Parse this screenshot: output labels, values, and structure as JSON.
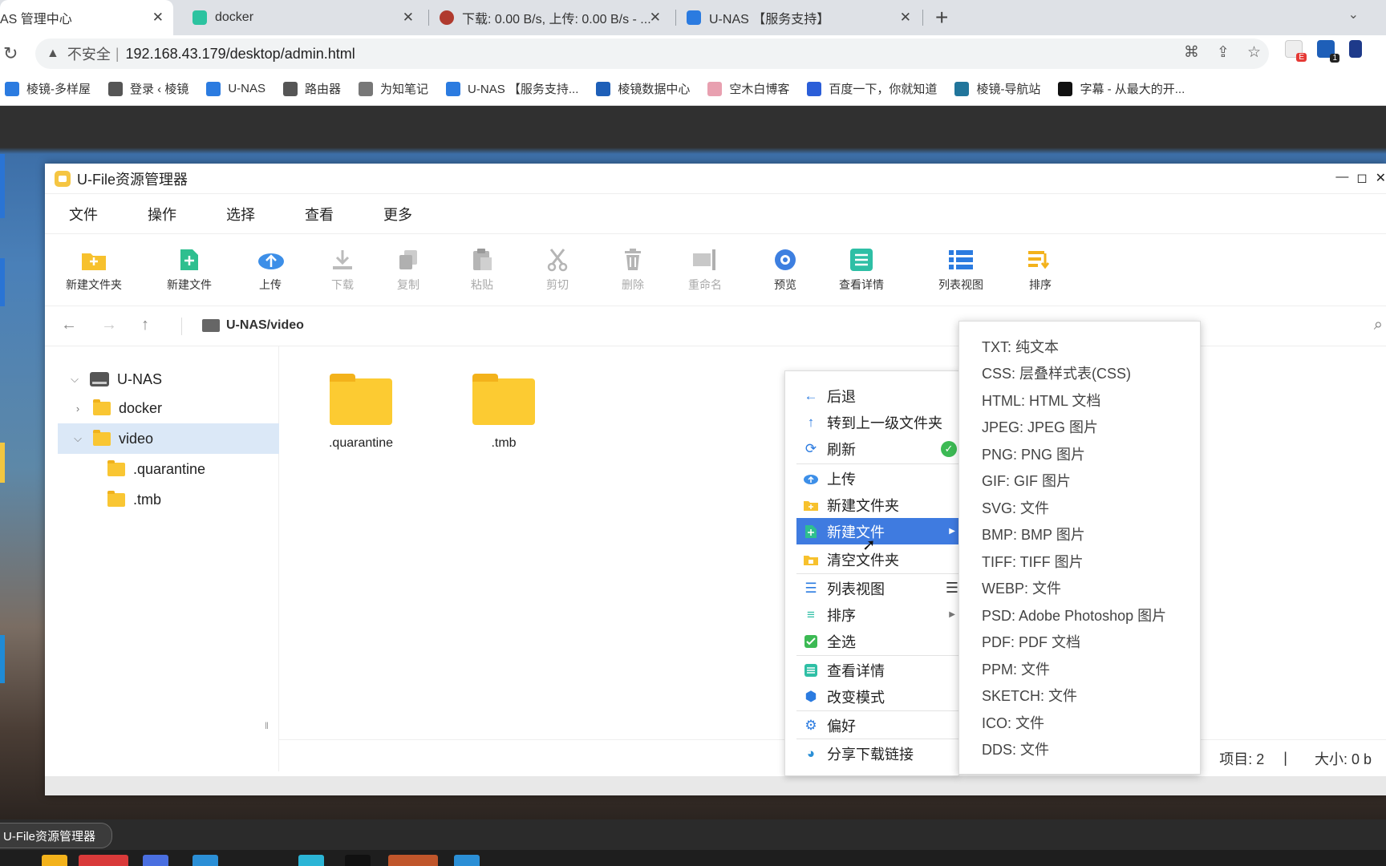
{
  "browser": {
    "tabs": [
      {
        "title": "AS 管理中心",
        "color": "#4b6fd6"
      },
      {
        "title": "docker",
        "color": "#2cc3a0"
      },
      {
        "title": "下载: 0.00 B/s, 上传: 0.00 B/s - ...",
        "color": "#c0392b"
      },
      {
        "title": "U-NAS 【服务支持】",
        "color": "#2b7be0"
      }
    ],
    "new_tab": "+",
    "address": {
      "security": "不安全",
      "url": "192.168.43.179/desktop/admin.html"
    },
    "bookmarks": [
      {
        "label": "棱镜-多样屋",
        "color": "#2b7be0"
      },
      {
        "label": "登录 ‹ 棱镜",
        "color": "#555555"
      },
      {
        "label": "U-NAS",
        "color": "#2b7be0"
      },
      {
        "label": "路由器",
        "color": "#555555"
      },
      {
        "label": "为知笔记",
        "color": "#777777"
      },
      {
        "label": "U-NAS 【服务支持...",
        "color": "#2b7be0"
      },
      {
        "label": "棱镜数据中心",
        "color": "#1e5fb8"
      },
      {
        "label": "空木白博客",
        "color": "#e8a0b0"
      },
      {
        "label": "百度一下，你就知道",
        "color": "#2b5ed8"
      },
      {
        "label": "棱镜-导航站",
        "color": "#21759b"
      },
      {
        "label": "字幕 - 从最大的开...",
        "color": "#111111"
      }
    ]
  },
  "window": {
    "title": "U-File资源管理器",
    "menus": [
      "文件",
      "操作",
      "选择",
      "查看",
      "更多"
    ],
    "toolbar": [
      {
        "label": "新建文件夹",
        "icon": "new-folder-icon",
        "enabled": true
      },
      {
        "label": "新建文件",
        "icon": "new-file-icon",
        "enabled": true
      },
      {
        "label": "上传",
        "icon": "upload-icon",
        "enabled": true
      },
      {
        "label": "下载",
        "icon": "download-icon",
        "enabled": false
      },
      {
        "label": "复制",
        "icon": "copy-icon",
        "enabled": false
      },
      {
        "label": "粘贴",
        "icon": "paste-icon",
        "enabled": false
      },
      {
        "label": "剪切",
        "icon": "cut-icon",
        "enabled": false
      },
      {
        "label": "删除",
        "icon": "delete-icon",
        "enabled": false
      },
      {
        "label": "重命名",
        "icon": "rename-icon",
        "enabled": false
      },
      {
        "label": "预览",
        "icon": "preview-icon",
        "enabled": true
      },
      {
        "label": "查看详情",
        "icon": "details-icon",
        "enabled": true
      },
      {
        "label": "列表视图",
        "icon": "list-view-icon",
        "enabled": true
      },
      {
        "label": "排序",
        "icon": "sort-icon",
        "enabled": true
      }
    ],
    "path": "U-NAS/video",
    "tree": [
      {
        "label": "U-NAS",
        "type": "drive",
        "expanded": true
      },
      {
        "label": "docker",
        "type": "folder",
        "expanded": false
      },
      {
        "label": "video",
        "type": "folder",
        "expanded": true,
        "selected": true
      },
      {
        "label": ".quarantine",
        "type": "folder"
      },
      {
        "label": ".tmb",
        "type": "folder"
      }
    ],
    "files": [
      ".quarantine",
      ".tmb"
    ],
    "status": {
      "items": "项目: 2",
      "sep": "|",
      "size": "大小: 0 b"
    }
  },
  "context_menu": {
    "items": [
      {
        "label": "后退",
        "icon": "arrow-left-icon"
      },
      {
        "label": "转到上一级文件夹",
        "icon": "arrow-up-icon"
      },
      {
        "label": "刷新",
        "icon": "refresh-icon"
      },
      {
        "label": "上传",
        "icon": "upload-icon"
      },
      {
        "label": "新建文件夹",
        "icon": "new-folder-icon"
      },
      {
        "label": "新建文件",
        "icon": "new-file-icon",
        "highlighted": true
      },
      {
        "label": "清空文件夹",
        "icon": "empty-folder-icon"
      },
      {
        "label": "列表视图",
        "icon": "list-view-icon"
      },
      {
        "label": "排序",
        "icon": "sort-icon"
      },
      {
        "label": "全选",
        "icon": "select-all-icon"
      },
      {
        "label": "查看详情",
        "icon": "details-icon"
      },
      {
        "label": "改变模式",
        "icon": "cube-icon"
      },
      {
        "label": "偏好",
        "icon": "gear-icon"
      },
      {
        "label": "分享下载链接",
        "icon": "share-icon"
      }
    ],
    "submenu": [
      "TXT: 纯文本",
      "CSS: 层叠样式表(CSS)",
      "HTML: HTML 文档",
      "JPEG: JPEG 图片",
      "PNG: PNG 图片",
      "GIF: GIF 图片",
      "SVG: 文件",
      "BMP: BMP 图片",
      "TIFF: TIFF 图片",
      "WEBP: 文件",
      "PSD: Adobe Photoshop 图片",
      "PDF: PDF 文档",
      "PPM: 文件",
      "SKETCH: 文件",
      "ICO: 文件",
      "DDS: 文件"
    ]
  },
  "taskbar": {
    "item": "U-File资源管理器"
  }
}
